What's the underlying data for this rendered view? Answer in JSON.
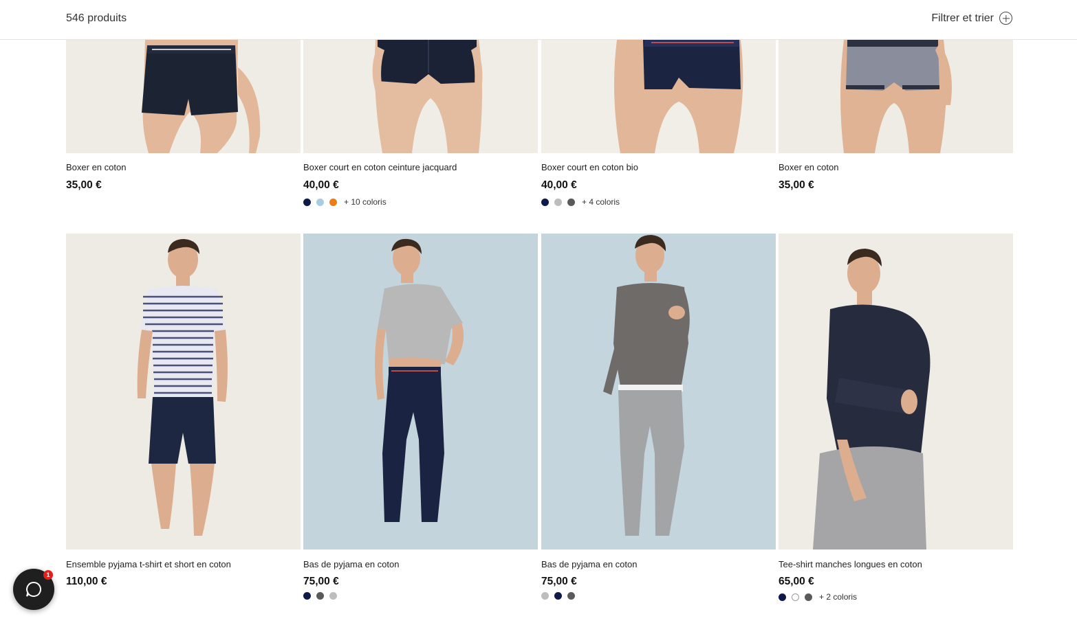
{
  "header": {
    "count": "546 produits",
    "filter_label": "Filtrer et trier"
  },
  "products": [
    {
      "name": "Boxer en coton",
      "price": "35,00 €",
      "swatches": [],
      "more": ""
    },
    {
      "name": "Boxer court en coton ceinture jacquard",
      "price": "40,00 €",
      "swatches": [
        "#0f1a4a",
        "#a9cde0",
        "#f07c14"
      ],
      "more": "+ 10 coloris"
    },
    {
      "name": "Boxer court en coton bio",
      "price": "40,00 €",
      "swatches": [
        "#0f1a4a",
        "#bdbdbd",
        "#5a5a5a"
      ],
      "more": "+ 4 coloris"
    },
    {
      "name": "Boxer en coton",
      "price": "35,00 €",
      "swatches": [],
      "more": ""
    },
    {
      "name": "Ensemble pyjama t-shirt et short en coton",
      "price": "110,00 €",
      "swatches": [],
      "more": ""
    },
    {
      "name": "Bas de pyjama en coton",
      "price": "75,00 €",
      "swatches": [
        "#0f1a4a",
        "#5a5a5a",
        "#bdbdbd"
      ],
      "more": ""
    },
    {
      "name": "Bas de pyjama en coton",
      "price": "75,00 €",
      "swatches": [
        "#bdbdbd",
        "#0f1a4a",
        "#5a5a5a"
      ],
      "more": ""
    },
    {
      "name": "Tee-shirt manches longues en coton",
      "price": "65,00 €",
      "swatches": [
        "#0f1a4a",
        "#ffffff",
        "#5a5a5a"
      ],
      "more": "+ 2 coloris"
    }
  ],
  "chat": {
    "badge": "1"
  }
}
